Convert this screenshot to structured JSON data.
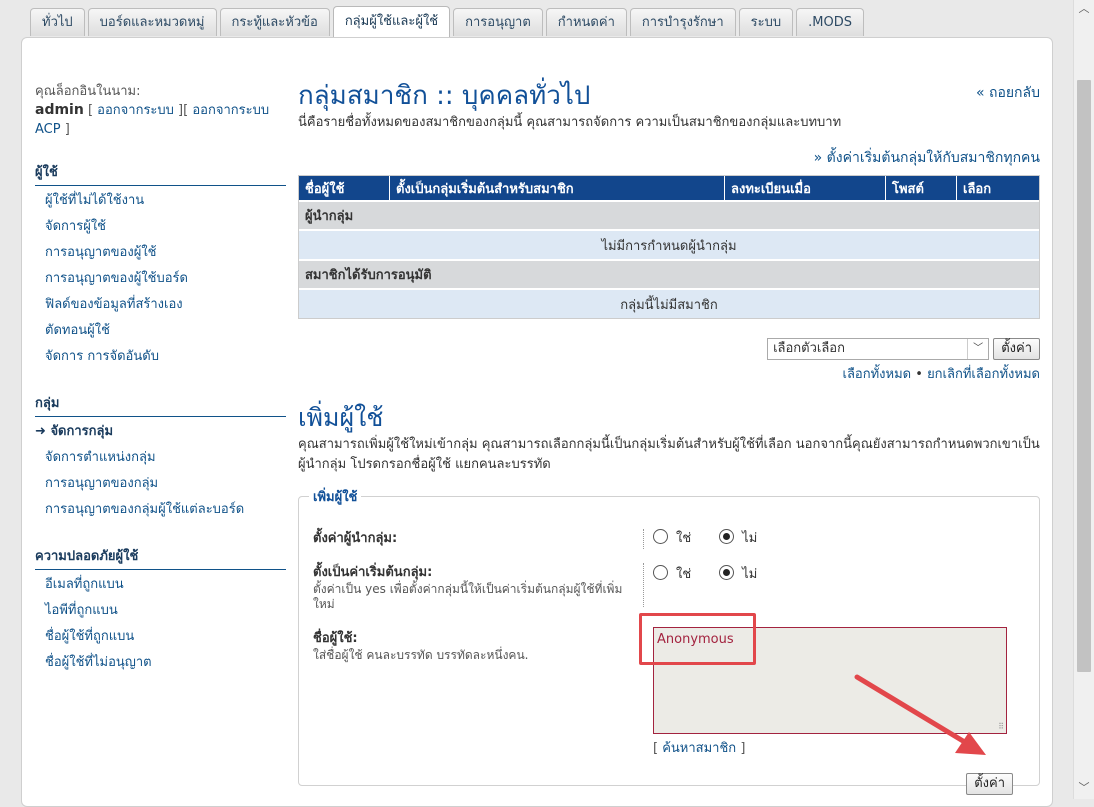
{
  "tabs": [
    "ทั่วไป",
    "บอร์ดและหมวดหมู่",
    "กระทู้และหัวข้อ",
    "กลุ่มผู้ใช้และผู้ใช้",
    "การอนุญาต",
    "กำหนดค่า",
    "การบำรุงรักษา",
    "ระบบ",
    ".MODS"
  ],
  "active_tab": 3,
  "sidebar": {
    "logged_in_as": "คุณล็อกอินในนาม:",
    "username": "admin",
    "logout": "ออกจากระบบ",
    "logout_acp": "ออกจากระบบ ACP",
    "sections": [
      {
        "title": "ผู้ใช้",
        "items": [
          "ผู้ใช้ที่ไม่ได้ใช้งาน",
          "จัดการผู้ใช้",
          "การอนุญาตของผู้ใช้",
          "การอนุญาตของผู้ใช้บอร์ด",
          "ฟิลด์ของข้อมูลที่สร้างเอง",
          "ตัดทอนผู้ใช้",
          "จัดการ การจัดอันดับ"
        ]
      },
      {
        "title": "กลุ่ม",
        "items": [
          "จัดการกลุ่ม",
          "จัดการตำแหน่งกลุ่ม",
          "การอนุญาตของกลุ่ม",
          "การอนุญาตของกลุ่มผู้ใช้แต่ละบอร์ด"
        ]
      },
      {
        "title": "ความปลอดภัยผู้ใช้",
        "items": [
          "อีเมลที่ถูกแบน",
          "ไอพีที่ถูกแบน",
          "ชื่อผู้ใช้ที่ถูกแบน",
          "ชื่อผู้ใช้ที่ไม่อนุญาต"
        ]
      }
    ],
    "current_item": "จัดการกลุ่ม"
  },
  "main": {
    "title": "กลุ่มสมาชิก :: บุคคลทั่วไป",
    "back": "« ถอยกลับ",
    "description": "นี่คือรายชื่อทั้งหมดของสมาชิกของกลุ่มนี้ คุณสามารถจัดการ ความเป็นสมาชิกของกลุ่มและบทบาท",
    "set_default_link": "» ตั้งค่าเริ่มต้นกลุ่มให้กับสมาชิกทุกคน",
    "table": {
      "headers": [
        "ชื่อผู้ใช้",
        "ตั้งเป็นกลุ่มเริ่มต้นสำหรับสมาชิก",
        "ลงทะเบียนเมื่อ",
        "โพสต์",
        "เลือก"
      ],
      "group_leaders": "ผู้นำกลุ่ม",
      "no_leaders": "ไม่มีการกำหนดผู้นำกลุ่ม",
      "approved_members": "สมาชิกได้รับการอนุมัติ",
      "no_members": "กลุ่มนี้ไม่มีสมาชิก"
    },
    "select_placeholder": "เลือกตัวเลือก",
    "submit_label": "ตั้งค่า",
    "mark_all": "เลือกทั้งหมด",
    "separator": "•",
    "unmark_all": "ยกเลิกที่เลือกทั้งหมด"
  },
  "add_users": {
    "heading": "เพิ่มผู้ใช้",
    "description": "คุณสามารถเพิ่มผู้ใช้ใหม่เข้ากลุ่ม คุณสามารถเลือกกลุ่มนี้เป็นกลุ่มเริ่มต้นสำหรับผู้ใช้ที่เลือก นอกจากนี้คุณยังสามารถกำหนดพวกเขาเป็นผู้นำกลุ่ม โปรดกรอกชื่อผู้ใช้ แยกคนละบรรทัด",
    "legend": "เพิ่มผู้ใช้",
    "leader_label": "ตั้งค่าผู้นำกลุ่ม:",
    "default_label": "ตั้งเป็นค่าเริ่มต้นกลุ่ม:",
    "default_help": "ตั้งค่าเป็น yes เพื่อตั้งค่ากลุ่มนี้ให้เป็นค่าเริ่มต้นกลุ่มผู้ใช้ที่เพิ่มใหม่",
    "yes": "ใช่",
    "no": "ไม่",
    "usernames_label": "ชื่อผู้ใช้:",
    "usernames_help": "ใส่ชื่อผู้ใช้ คนละบรรทัด บรรทัดละหนึ่งคน.",
    "usernames_value": "Anonymous",
    "find_open": "[",
    "find_member": "ค้นหาสมาชิก",
    "find_close": "]",
    "submit_label": "ตั้งค่า"
  },
  "colors": {
    "accent": "#105289",
    "header_blue": "#12468c",
    "annotation_red": "#e2474b"
  }
}
